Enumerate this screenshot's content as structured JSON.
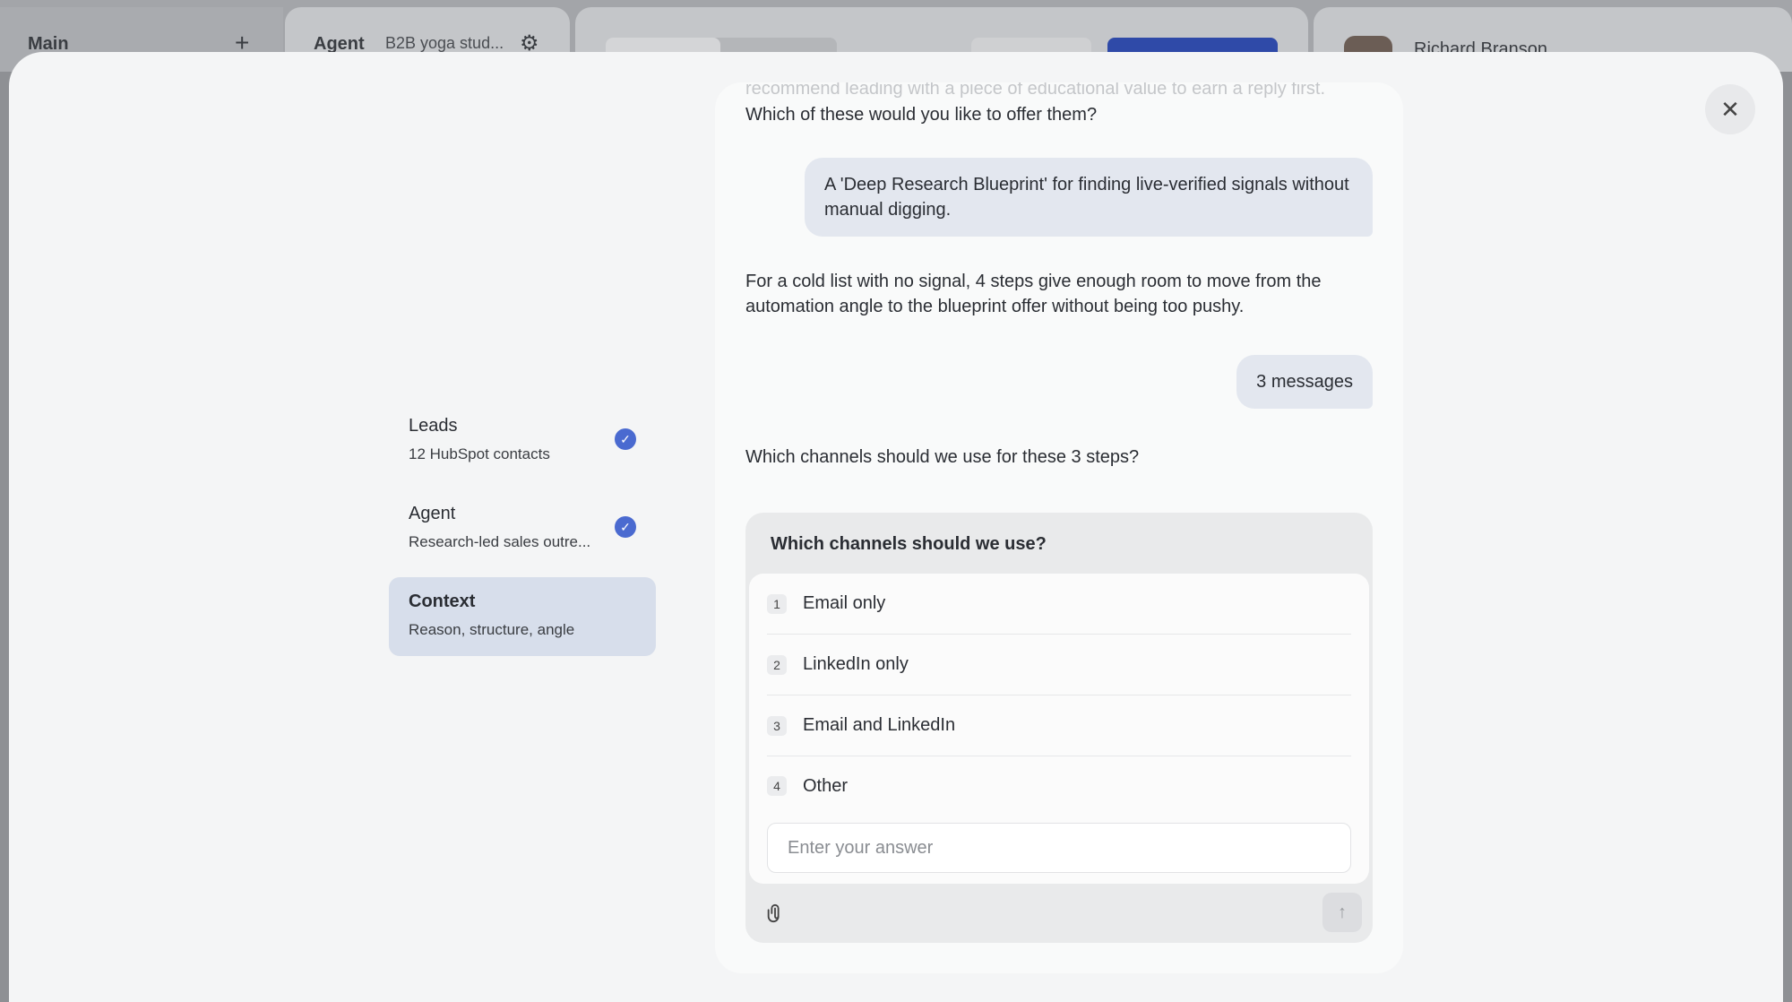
{
  "background": {
    "main_label": "Main",
    "agent_label": "Agent",
    "agent_sub": "B2B yoga stud...",
    "user_name": "Richard Branson"
  },
  "steps": [
    {
      "title": "Leads",
      "subtitle": "12 HubSpot contacts",
      "done": true
    },
    {
      "title": "Agent",
      "subtitle": "Research-led sales outre...",
      "done": true
    },
    {
      "title": "Context",
      "subtitle": "Reason, structure, angle",
      "done": false
    }
  ],
  "chat": {
    "faded_text": "recommend leading with a piece of educational value to earn a reply first.",
    "q_offer": "Which of these would you like to offer them?",
    "answer_offer": "A 'Deep Research Blueprint' for finding live-verified signals without manual digging.",
    "ai_steps": "For a cold list with no signal, 4 steps give enough room to move from the automation angle to the blueprint offer without being too pushy.",
    "answer_steps": "3 messages",
    "q_channels": "Which channels should we use for these 3 steps?"
  },
  "question_card": {
    "title": "Which channels should we use?",
    "options": [
      {
        "num": "1",
        "label": "Email only"
      },
      {
        "num": "2",
        "label": "LinkedIn only"
      },
      {
        "num": "3",
        "label": "Email and LinkedIn"
      },
      {
        "num": "4",
        "label": "Other"
      }
    ],
    "input_placeholder": "Enter your answer"
  },
  "icons": {
    "close": "close-icon",
    "attach": "paperclip-icon",
    "send": "arrow-up-icon",
    "check": "check-circle-icon"
  },
  "colors": {
    "accent": "#4a6ad0",
    "active_step_bg": "#d7deeb",
    "user_bubble": "#e3e7ef"
  }
}
